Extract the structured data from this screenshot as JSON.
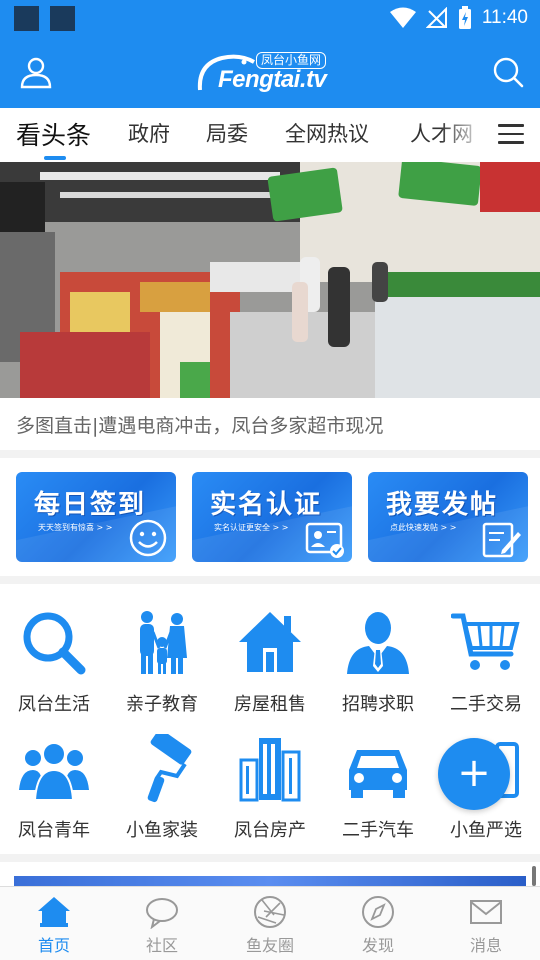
{
  "status_bar": {
    "time": "11:40"
  },
  "header": {
    "logo_small": "凤台小鱼网",
    "logo_main": "Fengtai.tv"
  },
  "tabs": [
    {
      "label": "看头条",
      "active": true
    },
    {
      "label": "政府",
      "active": false
    },
    {
      "label": "局委",
      "active": false
    },
    {
      "label": "全网热议",
      "active": false
    },
    {
      "label": "人才网",
      "active": false
    }
  ],
  "banner": {
    "caption": "多图直击|遭遇电商冲击，凤台多家超市现况"
  },
  "actions": [
    {
      "title": "每日签到",
      "subtitle": "天天签到有惊喜 > >",
      "icon": "smiley-icon"
    },
    {
      "title": "实名认证",
      "subtitle": "实名认证更安全 > >",
      "icon": "id-card-icon"
    },
    {
      "title": "我要发帖",
      "subtitle": "点此快速发帖 > >",
      "icon": "edit-icon"
    }
  ],
  "categories": [
    {
      "label": "凤台生活",
      "icon": "search-icon"
    },
    {
      "label": "亲子教育",
      "icon": "family-icon"
    },
    {
      "label": "房屋租售",
      "icon": "house-icon"
    },
    {
      "label": "招聘求职",
      "icon": "person-tie-icon"
    },
    {
      "label": "二手交易",
      "icon": "cart-icon"
    },
    {
      "label": "凤台青年",
      "icon": "group-icon"
    },
    {
      "label": "小鱼家装",
      "icon": "paint-roller-icon"
    },
    {
      "label": "凤台房产",
      "icon": "buildings-icon"
    },
    {
      "label": "二手汽车",
      "icon": "car-icon"
    },
    {
      "label": "小鱼严选",
      "icon": "bag-icon"
    }
  ],
  "fab": {
    "label": "+"
  },
  "bottom_nav": [
    {
      "label": "首页",
      "icon": "home-icon",
      "active": true
    },
    {
      "label": "社区",
      "icon": "chat-bubble-icon",
      "active": false
    },
    {
      "label": "鱼友圈",
      "icon": "aperture-icon",
      "active": false
    },
    {
      "label": "发现",
      "icon": "compass-icon",
      "active": false
    },
    {
      "label": "消息",
      "icon": "mail-icon",
      "active": false
    }
  ],
  "colors": {
    "brand_blue": "#1e8cf0",
    "text_dark": "#333333",
    "text_muted": "#999999"
  }
}
